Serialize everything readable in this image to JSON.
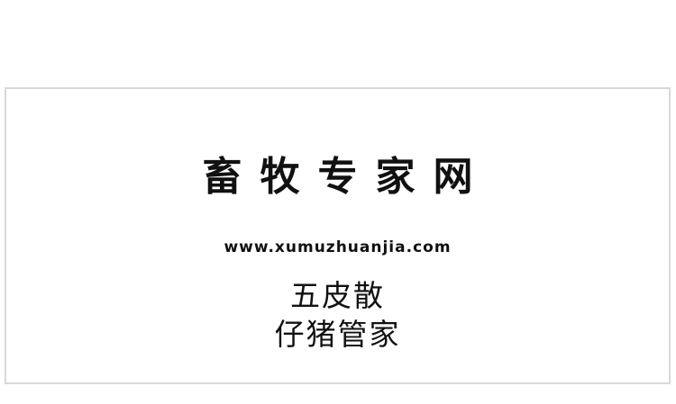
{
  "card": {
    "site_title": "畜牧专家网",
    "site_url": "www.xumuzhuanjia.com",
    "product_name": "五皮散",
    "product_subtitle": "仔猪管家"
  },
  "colors": {
    "text": "#111111",
    "border": "#d9d9d9",
    "background": "#ffffff"
  }
}
